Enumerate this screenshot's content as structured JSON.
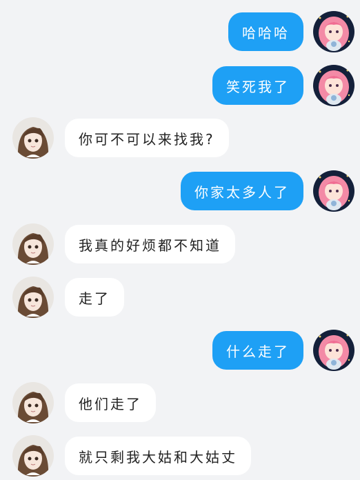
{
  "messages": [
    {
      "side": "right",
      "text": "哈哈哈"
    },
    {
      "side": "right",
      "text": "笑死我了"
    },
    {
      "side": "left",
      "text": "你可不可以来找我?"
    },
    {
      "side": "right",
      "text": "你家太多人了"
    },
    {
      "side": "left",
      "text": "我真的好烦都不知道"
    },
    {
      "side": "left",
      "text": "走了"
    },
    {
      "side": "right",
      "text": "什么走了"
    },
    {
      "side": "left",
      "text": "他们走了"
    },
    {
      "side": "left",
      "text": "就只剩我大姑和大姑丈"
    }
  ],
  "colors": {
    "background": "#f2f3f5",
    "sent_bubble": "#1ea0f5",
    "received_bubble": "#ffffff"
  },
  "icons": {
    "sender_avatar": "pink-hair-anime-girl-avatar",
    "receiver_avatar": "brown-hair-anime-girl-avatar"
  }
}
